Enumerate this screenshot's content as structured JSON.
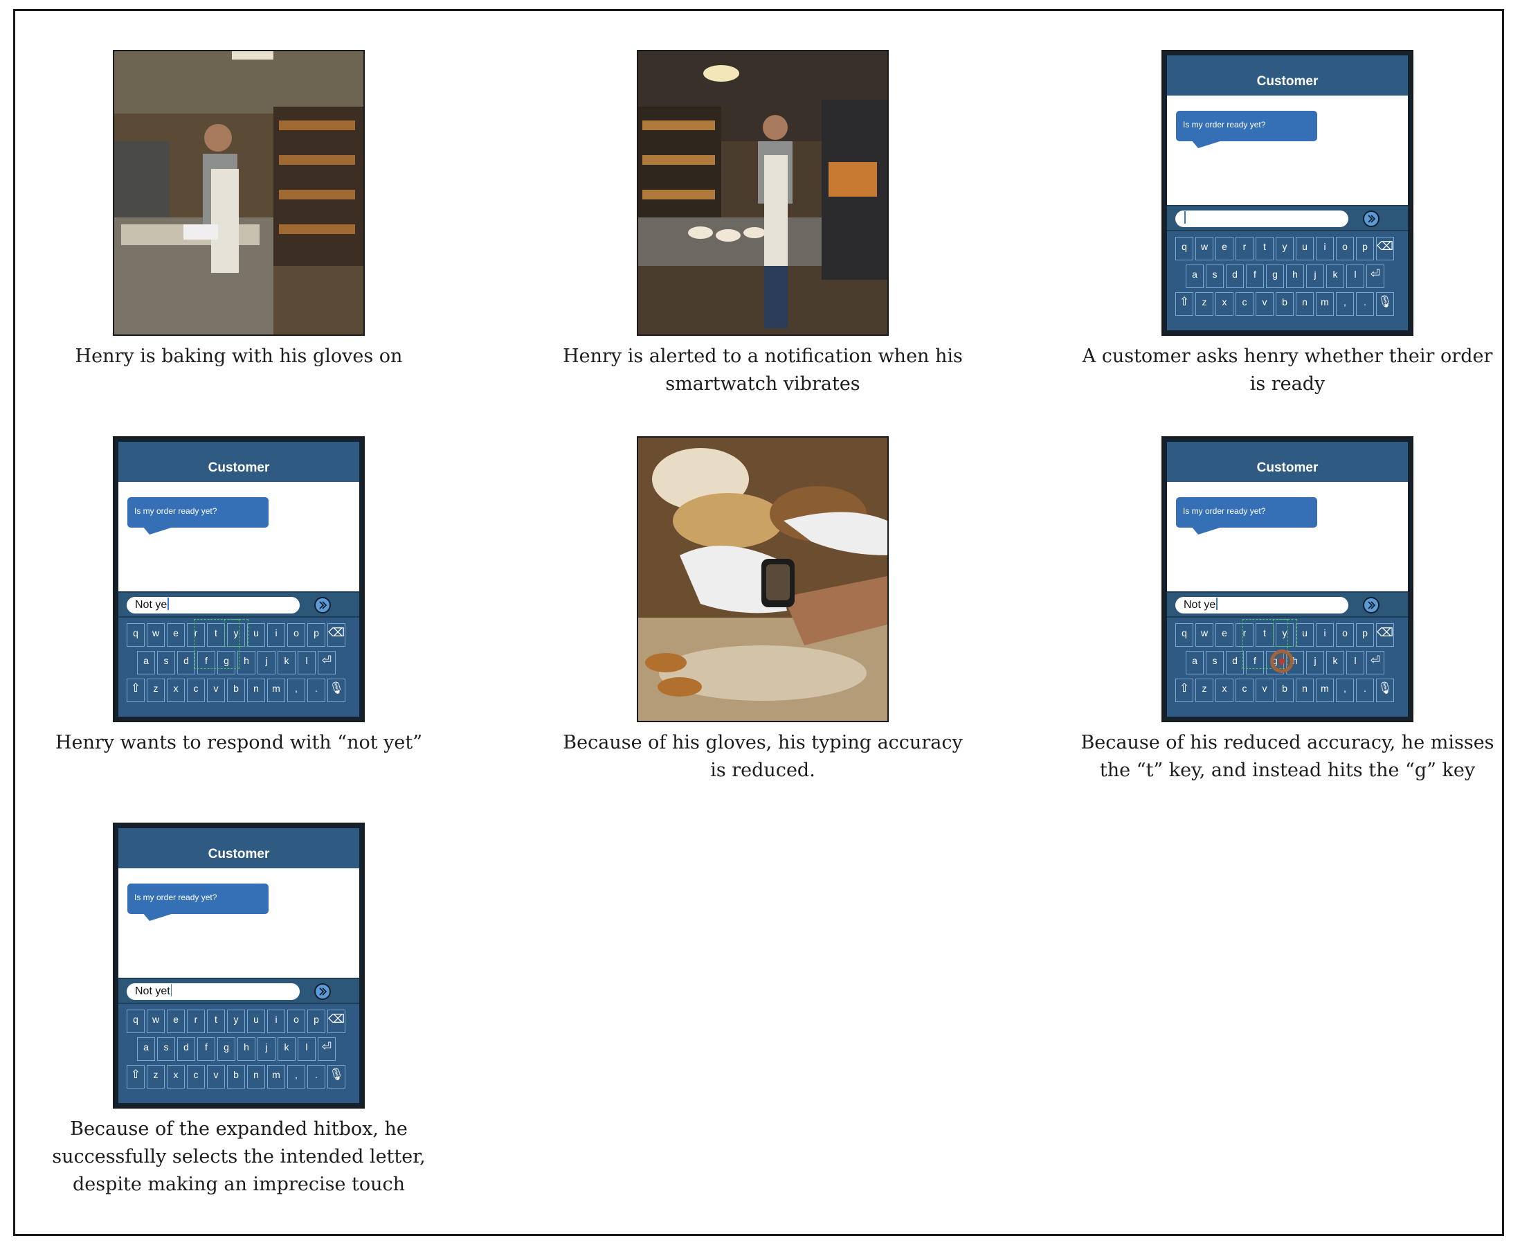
{
  "panels": [
    {
      "caption": "Henry is baking with his gloves on",
      "image": "photo-baking-with-gloves"
    },
    {
      "caption": "Henry is alerted to a notification when his smartwatch vibrates",
      "image": "photo-smartwatch-alert"
    },
    {
      "caption": "A customer asks henry whether their order is ready",
      "image": "phone-mockup"
    },
    {
      "caption": "Henry wants to respond with “not yet”",
      "image": "phone-mockup"
    },
    {
      "caption": "Because of his gloves, his typing accuracy is reduced.",
      "image": "photo-gloved-finger-on-watch"
    },
    {
      "caption": "Because of his reduced accuracy, he misses the “t” key, and instead hits the “g” key",
      "image": "phone-mockup"
    },
    {
      "caption": "Because of the expanded hitbox, he successfully selects the intended letter, despite making an imprecise touch",
      "image": "phone-mockup"
    }
  ],
  "phone": {
    "header_title": "Customer",
    "message": "Is my order ready yet?",
    "inputs": [
      "",
      "Not ye",
      "Not ye",
      "Not yet"
    ]
  },
  "keyboard": {
    "row1": [
      "q",
      "w",
      "e",
      "r",
      "t",
      "y",
      "u",
      "i",
      "o",
      "p"
    ],
    "row2": [
      "a",
      "s",
      "d",
      "f",
      "g",
      "h",
      "j",
      "k",
      "l"
    ],
    "row3": [
      "z",
      "x",
      "c",
      "v",
      "b",
      "n",
      "m",
      ",",
      "."
    ],
    "icons": {
      "backspace": "⌫",
      "enter": "⏎",
      "shift": "⇧",
      "mic": "🎙"
    }
  },
  "colors": {
    "phone_bg": "#2e5a83",
    "bubble": "#3570b6",
    "hitbox": "#4dbf5a",
    "touch": "#a0643c"
  }
}
